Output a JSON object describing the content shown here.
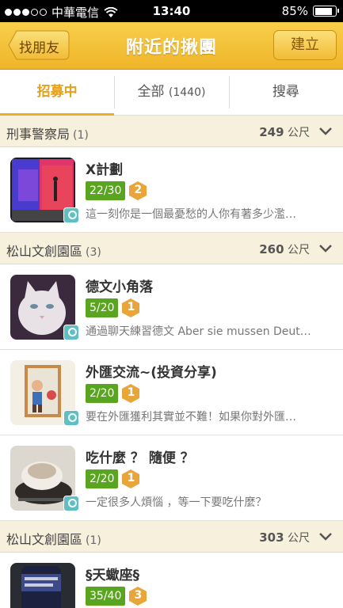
{
  "status": {
    "carrier": "中華電信",
    "time": "13:40",
    "battery": "85%",
    "battery_level": 0.85
  },
  "nav": {
    "back_label": "找朋友",
    "title": "附近的揪團",
    "create_label": "建立"
  },
  "tabs": [
    {
      "label": "招募中",
      "count": ""
    },
    {
      "label": "全部",
      "count": "(1440)"
    },
    {
      "label": "搜尋",
      "count": ""
    }
  ],
  "sections": [
    {
      "name": "刑事警察局",
      "count": "(1)",
      "distance": "249",
      "unit": "公尺",
      "items": [
        {
          "title": "X計劃",
          "members": "22/30",
          "level": "2",
          "desc": "這一刻你是一個最憂愁的人你有著多少濫…"
        }
      ]
    },
    {
      "name": "松山文創園區",
      "count": "(3)",
      "distance": "260",
      "unit": "公尺",
      "items": [
        {
          "title": "德文小角落",
          "members": "5/20",
          "level": "1",
          "desc": "通過聊天練習德文 Aber sie mussen Deut…"
        },
        {
          "title": "外匯交流~(投資分享)",
          "members": "2/20",
          "level": "1",
          "desc": "要在外匯獲利其實並不難！如果你對外匯…"
        },
        {
          "title": "吃什麼 ？ 隨便 ？",
          "members": "2/20",
          "level": "1",
          "desc": "一定很多人煩惱 ，等一下要吃什麼？"
        }
      ]
    },
    {
      "name": "松山文創園區",
      "count": "(1)",
      "distance": "303",
      "unit": "公尺",
      "items": [
        {
          "title": "§天蠍座§",
          "members": "35/40",
          "level": "3",
          "desc": ""
        }
      ]
    }
  ],
  "colors": {
    "accent": "#f0ae25",
    "member_badge": "#5aa51f",
    "level_badge": "#e7a53a",
    "pin": "#5fbfc4"
  }
}
